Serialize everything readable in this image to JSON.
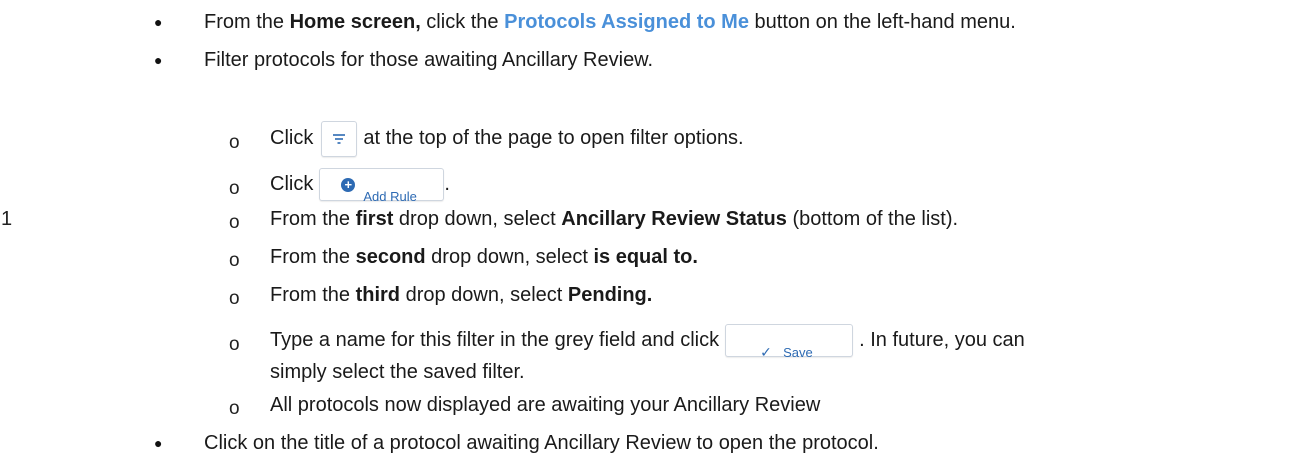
{
  "step_number": "1",
  "bullets": {
    "b1": {
      "prefix": "From the ",
      "home": "Home screen,",
      "mid": " click the ",
      "button_name": "Protocols Assigned to Me",
      "suffix": " button on the left-hand menu."
    },
    "b2": {
      "text": "Filter protocols for those awaiting Ancillary Review."
    },
    "b3": {
      "text": "Click on the title of a protocol awaiting Ancillary Review to open the protocol."
    }
  },
  "subitems": {
    "s1": {
      "prefix": "Click",
      "suffix": "at the top of the page to open filter options.",
      "icon": "filter-icon"
    },
    "s2": {
      "prefix": "Click",
      "suffix": ".",
      "button_label": "Add Rule",
      "icon": "plus-circle-icon"
    },
    "s3": {
      "prefix": "From the ",
      "ordinal": "first",
      "mid": " drop down, select ",
      "choice": "Ancillary Review Status",
      "suffix": " (bottom of the list)."
    },
    "s4": {
      "prefix": "From the ",
      "ordinal": "second",
      "mid": " drop down, select ",
      "choice": "is equal to."
    },
    "s5": {
      "prefix": "From the ",
      "ordinal": "third",
      "mid": " drop down, select ",
      "choice": "Pending."
    },
    "s6": {
      "prefix": "Type a name for this filter in the grey field and click",
      "suffix": ".  In future, you can",
      "cont": "simply select the saved filter.",
      "button_label": "Save",
      "icon": "check-icon"
    },
    "s7": {
      "text": "All protocols now displayed are awaiting your Ancillary Review"
    }
  },
  "markers": {
    "bullet": "●",
    "sub": "o"
  },
  "colors": {
    "link_blue": "#4a90d9",
    "button_blue": "#2d6ab3"
  }
}
